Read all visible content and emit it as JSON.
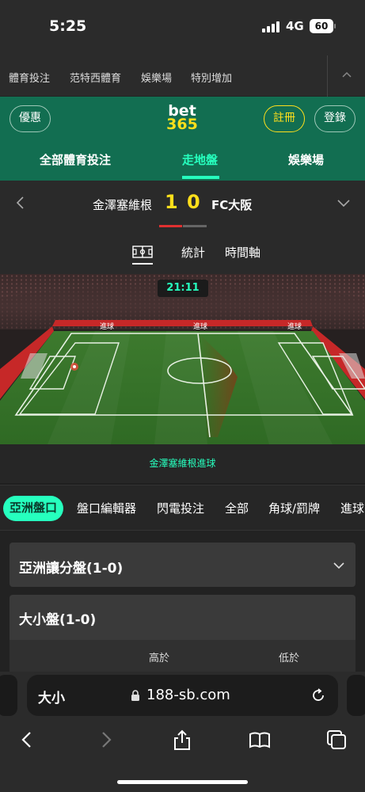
{
  "status": {
    "time": "5:25",
    "network": "4G",
    "battery": "60"
  },
  "topnav": {
    "items": [
      "體育投注",
      "范特西體育",
      "娛樂場",
      "特別增加"
    ]
  },
  "header": {
    "offer_label": "優惠",
    "logo_top": "bet",
    "logo_bottom": "365",
    "register_label": "註冊",
    "login_label": "登錄",
    "tabs": [
      "全部體育投注",
      "走地盤",
      "娛樂場"
    ],
    "active_tab": "走地盤"
  },
  "match": {
    "home_team": "金澤塞維根",
    "home_score": "1",
    "away_score": "0",
    "away_team": "FC大阪"
  },
  "views": {
    "stats_label": "統計",
    "timeline_label": "時間軸"
  },
  "field": {
    "clock": "21:11",
    "ad_text": "進球",
    "event_caption": "金澤塞維根進球"
  },
  "market_tabs": [
    "亞洲盤口",
    "盤口編輯器",
    "閃電投注",
    "全部",
    "角球/罰牌",
    "進球"
  ],
  "markets": {
    "handicap_title": "亞洲讓分盤(1-0)",
    "totals_title": "大小盤(1-0)",
    "over_label": "高於",
    "under_label": "低於"
  },
  "browser": {
    "text_size": "大小",
    "url": "188-sb.com"
  },
  "colors": {
    "brand_green": "#126e51",
    "accent_green": "#26ffbe",
    "bet365_yellow": "#ffdf1b",
    "score_yellow": "#ffdf1b"
  }
}
